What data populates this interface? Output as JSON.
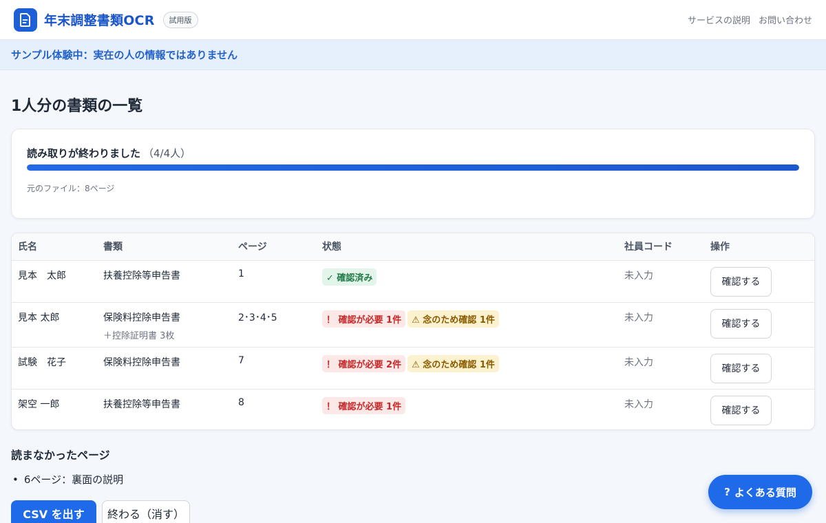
{
  "header": {
    "app_title": "年末調整書類OCR",
    "badge": "試用版",
    "nav": [
      "サービスの説明",
      "お問い合わせ"
    ]
  },
  "notice": "サンプル体験中：実在の人の情報ではありません",
  "page_title": "1人分の書類の一覧",
  "progress": {
    "status": "読み取りが終わりました",
    "count": "（4/4人）",
    "fraction": 1.0,
    "source": "元のファイル：8ページ"
  },
  "table": {
    "headers": [
      "氏名",
      "書類",
      "ページ",
      "状態",
      "社員コード",
      "操作"
    ],
    "rows": [
      {
        "name": "見本　太郎",
        "doc": "扶養控除等申告書",
        "doc_sub": "",
        "pages": "1",
        "status_ok": "✓ 確認済み",
        "status_err": "",
        "status_warn": "",
        "code": "未入力",
        "action": "確認する"
      },
      {
        "name": "見本 太郎",
        "doc": "保険料控除申告書",
        "doc_sub": "＋控除証明書 3枚",
        "pages": "2･3･4･5",
        "status_ok": "",
        "status_err": "！ 確認が必要 1件",
        "status_warn": "⚠ 念のため確認 1件",
        "code": "未入力",
        "action": "確認する"
      },
      {
        "name": "試験　花子",
        "doc": "保険料控除申告書",
        "doc_sub": "",
        "pages": "7",
        "status_ok": "",
        "status_err": "！ 確認が必要 2件",
        "status_warn": "⚠ 念のため確認 1件",
        "code": "未入力",
        "action": "確認する"
      },
      {
        "name": "架空 一郎",
        "doc": "扶養控除等申告書",
        "doc_sub": "",
        "pages": "8",
        "status_ok": "",
        "status_err": "！ 確認が必要 1件",
        "status_warn": "",
        "code": "未入力",
        "action": "確認する"
      }
    ]
  },
  "skipped": {
    "title": "読まなかったページ",
    "items": [
      "6ページ：裏面の説明"
    ]
  },
  "actions": {
    "csv": "CSV を出す",
    "end": "終わる（消す）"
  },
  "faq": {
    "icon": "?",
    "label": "よくある質問"
  },
  "colors": {
    "accent": "#1e6ae8",
    "brand": "#1a56c9",
    "ok": "#1f7a45",
    "error": "#c62828",
    "warn": "#8a5a00"
  }
}
